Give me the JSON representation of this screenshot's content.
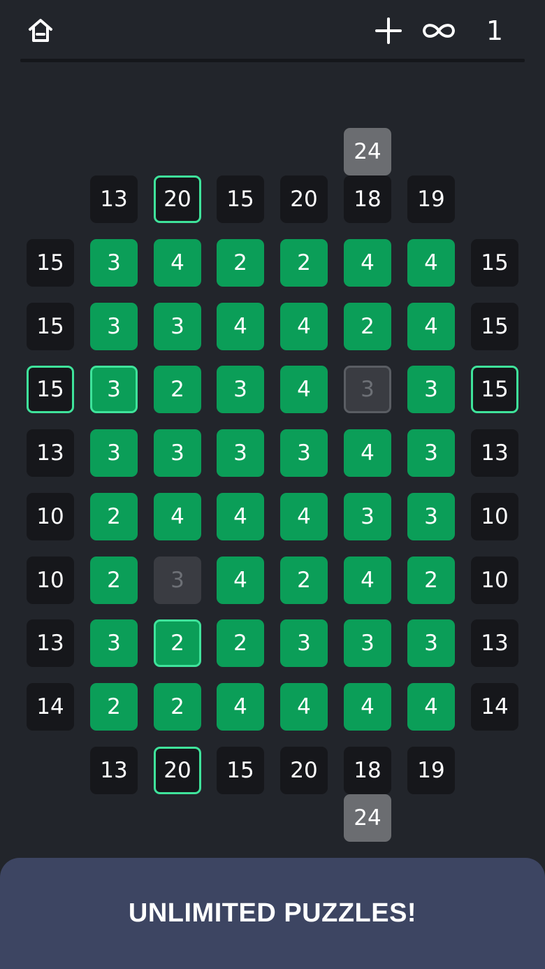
{
  "header": {
    "home_icon": "home-icon",
    "add_icon": "plus-icon",
    "infinity_icon": "infinity-icon",
    "counter": "1"
  },
  "board": {
    "top_sum": "24",
    "bottom_sum": "24",
    "top_clues": [
      "13",
      "20",
      "15",
      "20",
      "18",
      "19"
    ],
    "bottom_clues": [
      "13",
      "20",
      "15",
      "20",
      "18",
      "19"
    ],
    "left_clues": [
      "15",
      "15",
      "15",
      "13",
      "10",
      "10",
      "13",
      "14"
    ],
    "right_clues": [
      "15",
      "15",
      "15",
      "13",
      "10",
      "10",
      "13",
      "14"
    ],
    "rows": [
      [
        "3",
        "4",
        "2",
        "2",
        "4",
        "4"
      ],
      [
        "3",
        "3",
        "4",
        "4",
        "2",
        "4"
      ],
      [
        "3",
        "2",
        "3",
        "4",
        "3",
        "3"
      ],
      [
        "3",
        "3",
        "3",
        "3",
        "4",
        "3"
      ],
      [
        "2",
        "4",
        "4",
        "4",
        "3",
        "3"
      ],
      [
        "2",
        "3",
        "4",
        "2",
        "4",
        "2"
      ],
      [
        "3",
        "2",
        "2",
        "3",
        "3",
        "3"
      ],
      [
        "2",
        "2",
        "4",
        "4",
        "4",
        "4"
      ]
    ],
    "off_cells": [
      [
        2,
        4
      ],
      [
        5,
        1
      ]
    ],
    "highlight_cells": [
      [
        2,
        0
      ],
      [
        6,
        1
      ]
    ],
    "highlight_top_cols": [
      1
    ],
    "highlight_bottom_cols": [
      1
    ],
    "highlight_rows": [
      2
    ],
    "colors": {
      "background": "#22252b",
      "clue": "#16171b",
      "active": "#0b9e58",
      "off": "#3a3c42",
      "highlight": "#3fe39b",
      "sum": "#6b6d71"
    }
  },
  "banner": {
    "text": "UNLIMITED PUZZLES!",
    "background": "#3d4562"
  }
}
